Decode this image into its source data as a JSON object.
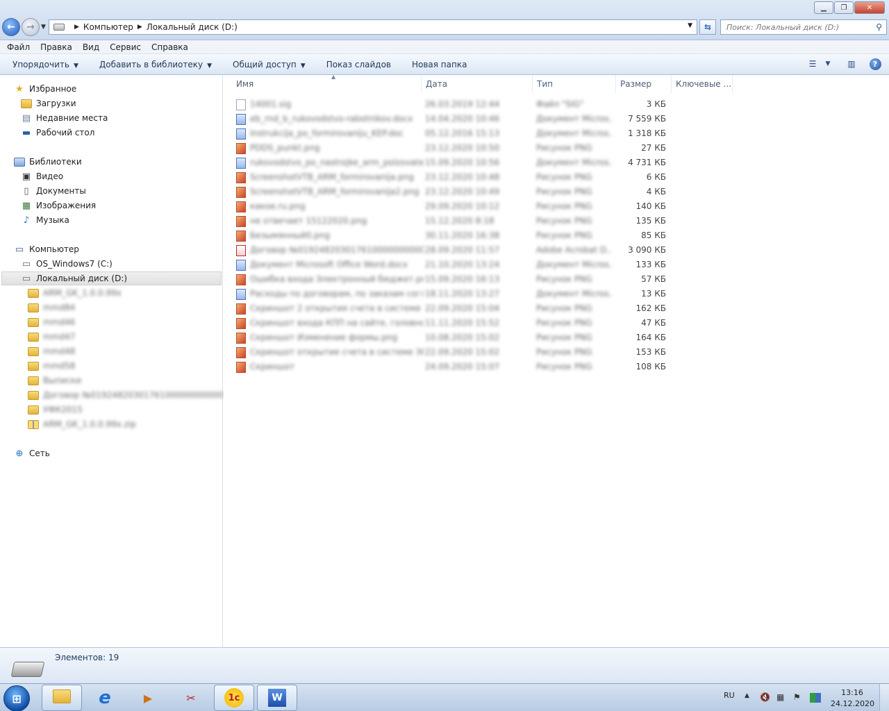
{
  "address": {
    "crumbs": [
      "Компьютер",
      "Локальный диск (D:)"
    ],
    "search_placeholder": "Поиск: Локальный диск (D:)"
  },
  "menu": [
    "Файл",
    "Правка",
    "Вид",
    "Сервис",
    "Справка"
  ],
  "commands": {
    "organize": "Упорядочить",
    "add_library": "Добавить в библиотеку",
    "share": "Общий доступ",
    "slideshow": "Показ слайдов",
    "new_folder": "Новая папка"
  },
  "nav": {
    "favorites": "Избранное",
    "downloads": "Загрузки",
    "recent": "Недавние места",
    "desktop": "Рабочий стол",
    "libraries": "Библиотеки",
    "video": "Видео",
    "documents": "Документы",
    "images": "Изображения",
    "music": "Музыка",
    "computer": "Компьютер",
    "drive_c": "OS_Windows7 (C:)",
    "drive_d": "Локальный диск (D:)",
    "network": "Сеть",
    "subfolders": [
      "ARM_GK_1.0.0.99x",
      "mmd84",
      "mmd46",
      "mmd47",
      "mmd48",
      "mmd58",
      "Выписки",
      "Договор №0192482030176100000000000",
      "УФК2015",
      "ARM_GK_1.0.0.99x.zip"
    ]
  },
  "columns": {
    "name": "Имя",
    "date": "Дата",
    "type": "Тип",
    "size": "Размер",
    "tags": "Ключевые ..."
  },
  "files": [
    {
      "name": "14001.sig",
      "date": "26.03.2019 12:44",
      "type": "Файл \"SIG\"",
      "size": "3 КБ",
      "icon": "file"
    },
    {
      "name": "eb_rnd_b_rukovodstvo-rabotnikov.docx",
      "date": "14.04.2020 10:46",
      "type": "Документ Micros...",
      "size": "7 559 КБ",
      "icon": "doc"
    },
    {
      "name": "Instrukcija_po_formirovaniju_KEP.doc",
      "date": "05.12.2016 15:13",
      "type": "Документ Micros...",
      "size": "1 318 КБ",
      "icon": "doc"
    },
    {
      "name": "PDDS_punkt.png",
      "date": "23.12.2020 10:50",
      "type": "Рисунок PNG",
      "size": "27 КБ",
      "icon": "png"
    },
    {
      "name": "rukovodstvo_po_nastrojke_arm_polzovatel...",
      "date": "15.09.2020 10:56",
      "type": "Документ Micros...",
      "size": "4 731 КБ",
      "icon": "doc"
    },
    {
      "name": "ScreenshotVTB_ARM_formirovanija.png",
      "date": "23.12.2020 10:48",
      "type": "Рисунок PNG",
      "size": "6 КБ",
      "icon": "png"
    },
    {
      "name": "ScreenshotVTB_ARM_formirovanija2.png",
      "date": "23.12.2020 10:49",
      "type": "Рисунок PNG",
      "size": "4 КБ",
      "icon": "png"
    },
    {
      "name": "            какое.ru.png",
      "date": "29.09.2020 10:12",
      "type": "Рисунок PNG",
      "size": "140 КБ",
      "icon": "png"
    },
    {
      "name": "            не отвечает 15122020.png",
      "date": "15.12.2020 8:18",
      "type": "Рисунок PNG",
      "size": "135 КБ",
      "icon": "png"
    },
    {
      "name": "Безымянный0.png",
      "date": "30.11.2020 16:38",
      "type": "Рисунок PNG",
      "size": "85 КБ",
      "icon": "png"
    },
    {
      "name": "Договор №0192482030176100000000000_7...",
      "date": "28.09.2020 11:57",
      "type": "Adobe Acrobat D...",
      "size": "3 090 КБ",
      "icon": "pdf"
    },
    {
      "name": "Документ Microsoft Office Word.docx",
      "date": "21.10.2020 13:24",
      "type": "Документ Micros...",
      "size": "133 КБ",
      "icon": "doc"
    },
    {
      "name": "Ошибка входа Электронный бюджет.png",
      "date": "15.09.2020 16:13",
      "type": "Рисунок PNG",
      "size": "57 КБ",
      "icon": "png"
    },
    {
      "name": "Расходы по договорам, по заказам соглa...",
      "date": "18.11.2020 13:27",
      "type": "Документ Micros...",
      "size": "13 КБ",
      "icon": "doc"
    },
    {
      "name": "Скриншот 2 открытия счета в системе 36...",
      "date": "22.09.2020 15:04",
      "type": "Рисунок PNG",
      "size": "162 КБ",
      "icon": "png"
    },
    {
      "name": "Скриншот входа КПП на сайте, головно...",
      "date": "11.11.2020 15:52",
      "type": "Рисунок PNG",
      "size": "47 КБ",
      "icon": "png"
    },
    {
      "name": "Скриншот Изменение формы.png",
      "date": "10.08.2020 15:02",
      "type": "Рисунок PNG",
      "size": "164 КБ",
      "icon": "png"
    },
    {
      "name": "Скриншот открытие счета в системе 36.p...",
      "date": "22.09.2020 15:02",
      "type": "Рисунок PNG",
      "size": "153 КБ",
      "icon": "png"
    },
    {
      "name": "Скриншот",
      "date": "24.09.2020 15:07",
      "type": "Рисунок PNG",
      "size": "108 КБ",
      "icon": "png"
    }
  ],
  "status": {
    "count": "Элементов: 19"
  },
  "taskbar": {
    "lang": "RU",
    "time": "13:16",
    "date": "24.12.2020",
    "app_1c": "1c",
    "app_word": "W",
    "app_ie": "e"
  }
}
